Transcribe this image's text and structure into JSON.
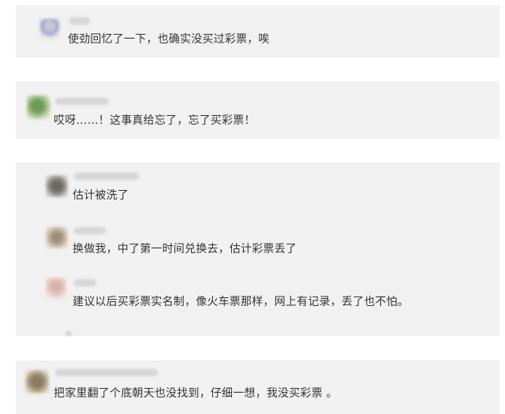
{
  "comments_cards": [
    {
      "comments": [
        {
          "avatar_icon": "user-avatar-icon",
          "text": "使劲回忆了一下，也确实没买过彩票，唉"
        }
      ]
    },
    {
      "comments": [
        {
          "avatar_icon": "user-avatar-icon",
          "text": "哎呀……！这事真给忘了，忘了买彩票！"
        }
      ]
    },
    {
      "comments": [
        {
          "avatar_icon": "user-avatar-icon",
          "text": "估计被洗了"
        },
        {
          "avatar_icon": "user-avatar-icon",
          "text": "换做我，中了第一时间兑换去，估计彩票丢了"
        },
        {
          "avatar_icon": "user-avatar-icon",
          "text": "建议以后买彩票实名制，像火车票那样，网上有记录，丢了也不怕。"
        }
      ]
    },
    {
      "comments": [
        {
          "avatar_icon": "user-avatar-icon",
          "text": "把家里翻了个底朝天也没找到，仔细一想，我没买彩票 。"
        }
      ]
    }
  ]
}
